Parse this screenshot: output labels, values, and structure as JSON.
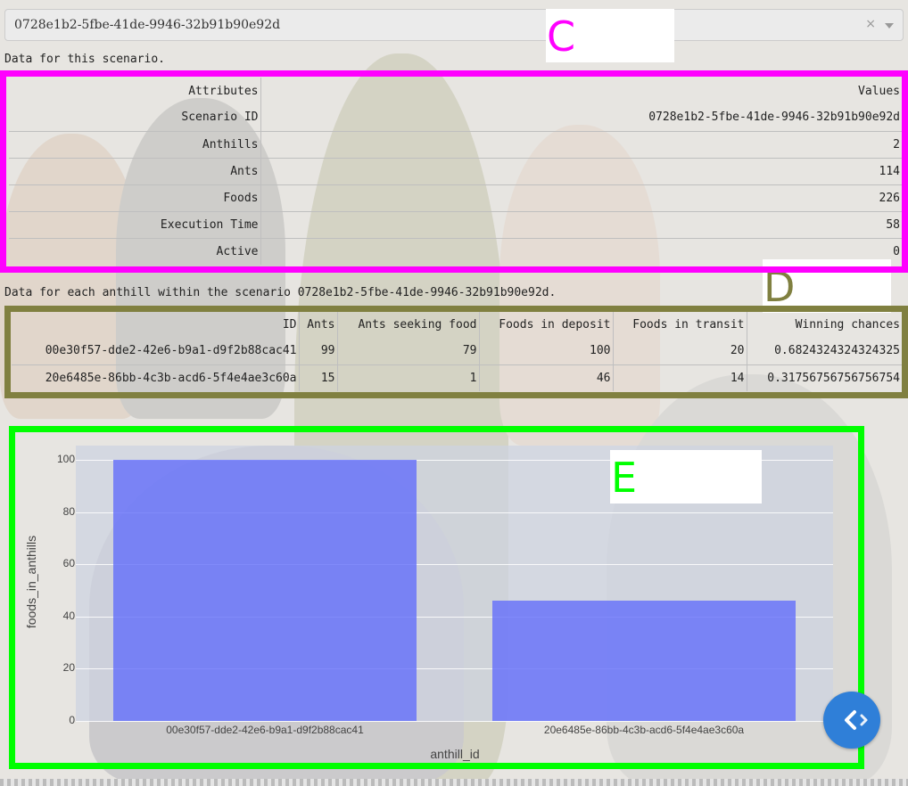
{
  "dropdown": {
    "value": "0728e1b2-5fbe-41de-9946-32b91b90e92d",
    "clear_glyph": "×"
  },
  "labels": {
    "c": "C",
    "d": "D",
    "e": "E"
  },
  "label_colors": {
    "c": "#ff00ff",
    "d": "#808040",
    "e": "#00ff00"
  },
  "scenario": {
    "caption": "Data for this scenario.",
    "headers": [
      "Attributes",
      "Values"
    ],
    "rows": [
      [
        "Scenario ID",
        "0728e1b2-5fbe-41de-9946-32b91b90e92d"
      ],
      [
        "Anthills",
        "2"
      ],
      [
        "Ants",
        "114"
      ],
      [
        "Foods",
        "226"
      ],
      [
        "Execution Time",
        "58"
      ],
      [
        "Active",
        "0"
      ]
    ]
  },
  "anthills": {
    "caption": "Data for each anthill within the scenario 0728e1b2-5fbe-41de-9946-32b91b90e92d.",
    "headers": [
      "ID",
      "Ants",
      "Ants seeking food",
      "Foods in deposit",
      "Foods in transit",
      "Winning chances"
    ],
    "rows": [
      [
        "00e30f57-dde2-42e6-b9a1-d9f2b88cac41",
        "99",
        "79",
        "100",
        "20",
        "0.6824324324324325"
      ],
      [
        "20e6485e-86bb-4c3b-acd6-5f4e4ae3c60a",
        "15",
        "1",
        "46",
        "14",
        "0.31756756756756754"
      ]
    ]
  },
  "chart_data": {
    "type": "bar",
    "categories": [
      "00e30f57-dde2-42e6-b9a1-d9f2b88cac41",
      "20e6485e-86bb-4c3b-acd6-5f4e4ae3c60a"
    ],
    "values": [
      100,
      46
    ],
    "xlabel": "anthill_id",
    "ylabel": "foods_in_anthills",
    "ylim": [
      0,
      105
    ],
    "yticks": [
      "0",
      "20",
      "40",
      "60",
      "80",
      "100"
    ],
    "bar_color": "#636efa",
    "grid": true
  },
  "nav_button": {
    "icon": "chevron-left-right-icon",
    "color": "#2f7fd8"
  }
}
